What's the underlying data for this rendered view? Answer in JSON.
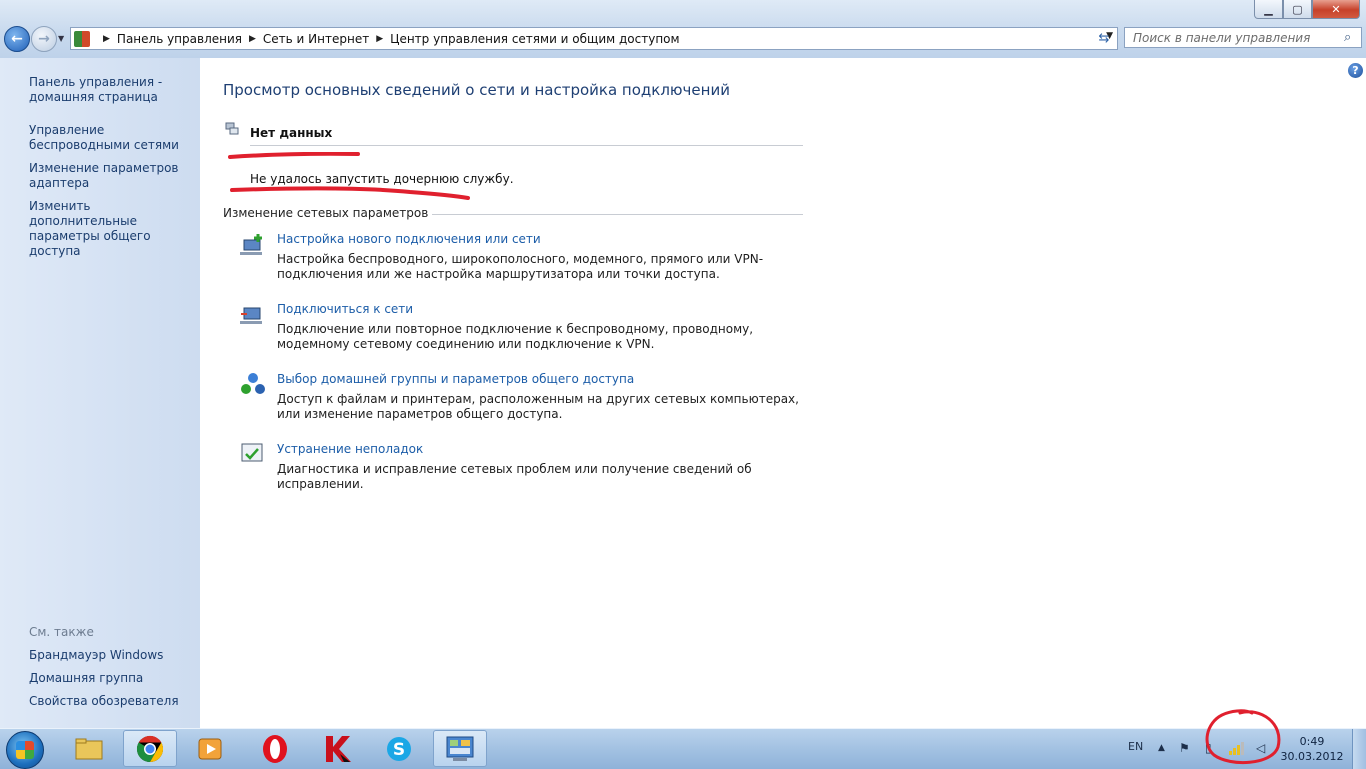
{
  "window": {
    "minimize": "▁",
    "maximize": "▢",
    "close": "✕"
  },
  "nav": {
    "back_icon": "back-arrow-icon",
    "forward_icon": "forward-arrow-icon"
  },
  "address": {
    "crumbs": [
      "Панель управления",
      "Сеть и Интернет",
      "Центр управления сетями и общим доступом"
    ]
  },
  "search": {
    "placeholder": "Поиск в панели управления"
  },
  "sidebar": {
    "items": [
      {
        "label": "Панель управления - домашняя страница"
      },
      {
        "label": "Управление беспроводными сетями"
      },
      {
        "label": "Изменение параметров адаптера"
      },
      {
        "label": "Изменить дополнительные параметры общего доступа"
      }
    ],
    "see_also_title": "См. также",
    "see_also": [
      {
        "label": "Брандмауэр Windows"
      },
      {
        "label": "Домашняя группа"
      },
      {
        "label": "Свойства обозревателя"
      }
    ]
  },
  "main": {
    "title": "Просмотр основных сведений о сети и настройка подключений",
    "network_status": "Нет данных",
    "error": "Не удалось запустить дочернюю службу.",
    "section_title": "Изменение сетевых параметров",
    "tasks": [
      {
        "title": "Настройка нового подключения или сети",
        "desc": "Настройка беспроводного, широкополосного, модемного, прямого или VPN-подключения или же настройка маршрутизатора или точки доступа.",
        "icon": "new-connection-icon"
      },
      {
        "title": "Подключиться к сети",
        "desc": "Подключение или повторное подключение к беспроводному, проводному, модемному сетевому соединению или подключение к VPN.",
        "icon": "connect-network-icon"
      },
      {
        "title": "Выбор домашней группы и параметров общего доступа",
        "desc": "Доступ к файлам и принтерам, расположенным на других сетевых компьютерах, или изменение параметров общего доступа.",
        "icon": "homegroup-icon"
      },
      {
        "title": "Устранение неполадок",
        "desc": "Диагностика и исправление сетевых проблем или получение сведений об исправлении.",
        "icon": "troubleshoot-icon"
      }
    ]
  },
  "taskbar": {
    "apps": [
      "explorer",
      "chrome",
      "media-player",
      "opera",
      "kaspersky",
      "skype",
      "control-panel"
    ],
    "lang": "EN",
    "time": "0:49",
    "date": "30.03.2012"
  },
  "colors": {
    "link": "#1c5da8",
    "title": "#1e3f73",
    "sidebar_link": "#1b3d6e",
    "scribble": "#e0202e"
  }
}
